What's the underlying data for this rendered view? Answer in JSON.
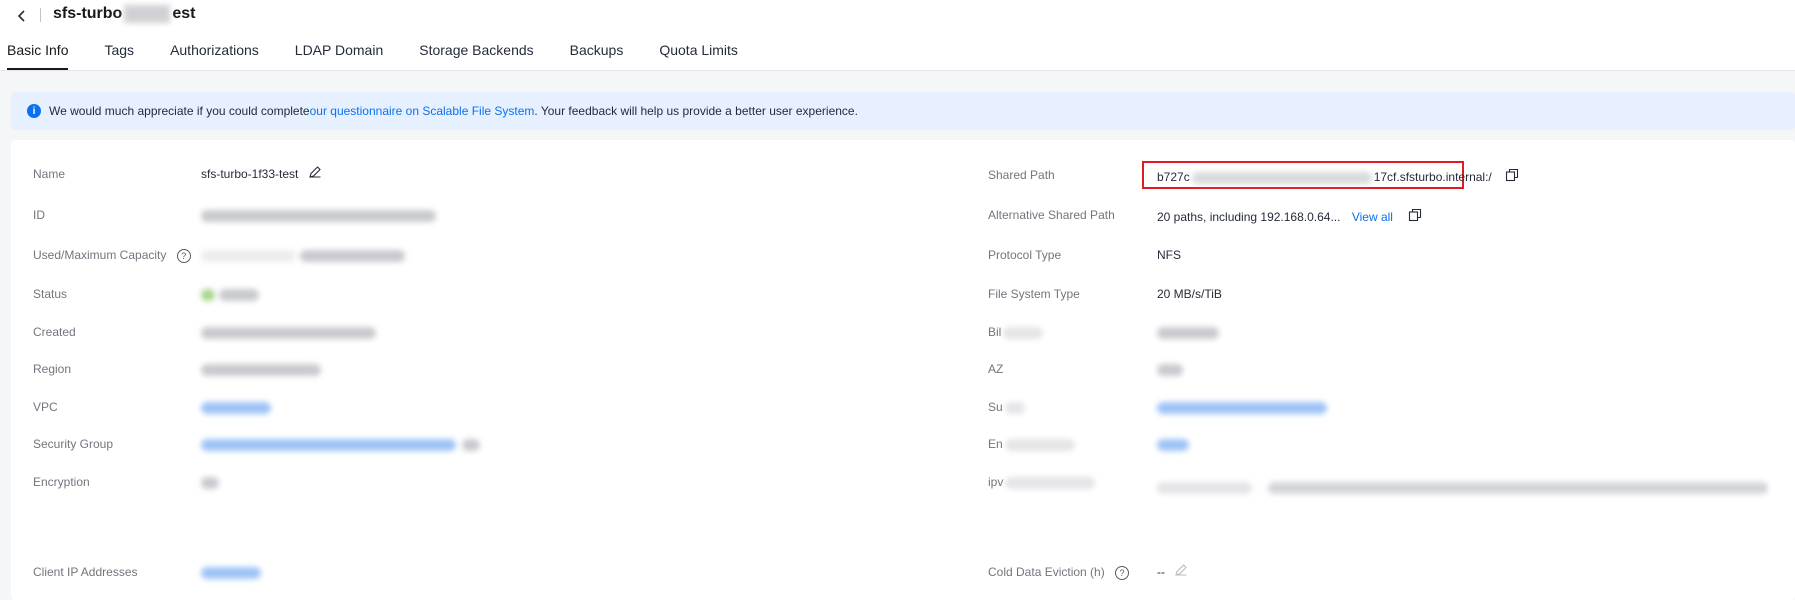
{
  "header": {
    "title_prefix": "sfs-turbo",
    "title_suffix": "est"
  },
  "tabs": [
    {
      "label": "Basic Info"
    },
    {
      "label": "Tags"
    },
    {
      "label": "Authorizations"
    },
    {
      "label": "LDAP Domain"
    },
    {
      "label": "Storage Backends"
    },
    {
      "label": "Backups"
    },
    {
      "label": "Quota Limits"
    }
  ],
  "notice": {
    "text_before": "We would much appreciate if you could complete ",
    "link_text": "our questionnaire on Scalable File System",
    "text_after": ". Your feedback will help us provide a better user experience."
  },
  "left_fields": {
    "name_label": "Name",
    "name_value": "sfs-turbo-1f33-test",
    "id_label": "ID",
    "capacity_label": "Used/Maximum Capacity",
    "status_label": "Status",
    "created_label": "Created",
    "region_label": "Region",
    "vpc_label": "VPC",
    "security_group_label": "Security Group",
    "encryption_label": "Encryption",
    "client_ip_label": "Client IP Addresses"
  },
  "right_fields": {
    "shared_path_label": "Shared Path",
    "shared_path_prefix": "b727c",
    "shared_path_suffix": "17cf.sfsturbo.internal:/",
    "alt_path_label": "Alternative Shared Path",
    "alt_path_value": "20 paths, including 192.168.0.64...",
    "alt_path_link": "View all",
    "protocol_label": "Protocol Type",
    "protocol_value": "NFS",
    "fs_type_label": "File System Type",
    "fs_type_value": "20 MB/s/TiB",
    "billing_label_partial": "Bil",
    "az_label": "AZ",
    "subnet_label_partial": "Su",
    "enterprise_label_partial": "En",
    "ipv_label_partial": "ipv",
    "cold_data_label": "Cold Data Eviction (h)",
    "cold_data_value": "--"
  }
}
